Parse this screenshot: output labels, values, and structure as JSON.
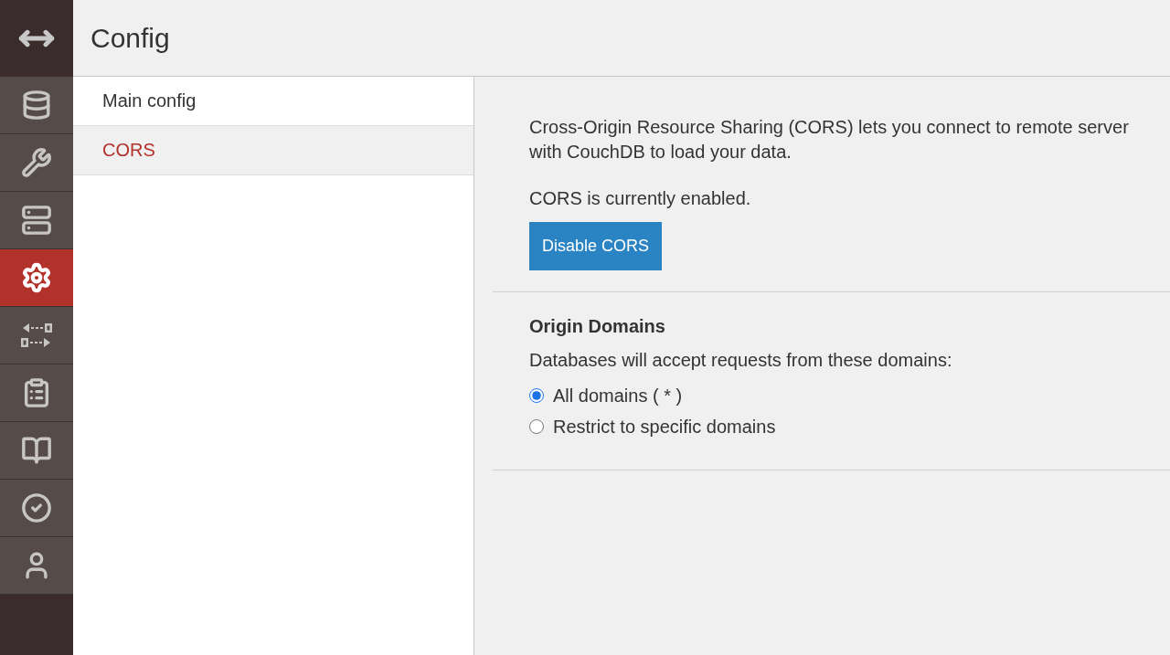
{
  "header": {
    "title": "Config"
  },
  "nav_items": [
    {
      "selected": false
    },
    {
      "selected": false
    },
    {
      "selected": false
    },
    {
      "selected": true
    },
    {
      "selected": false
    },
    {
      "selected": false
    },
    {
      "selected": false
    },
    {
      "selected": false
    },
    {
      "selected": false
    }
  ],
  "config_menu": [
    {
      "label": "Main config",
      "selected": false
    },
    {
      "label": "CORS",
      "selected": true
    }
  ],
  "cors": {
    "description_lines": [
      "Cross-Origin Resource Sharing (CORS) lets you connect to remote server",
      "with CouchDB to load your data."
    ],
    "status": "CORS is currently enabled.",
    "button": "Disable CORS"
  },
  "origin_domains": {
    "heading": "Origin Domains",
    "hint": "Databases will accept requests from these domains:",
    "options": [
      {
        "label": "All domains ( * )",
        "selected": true
      },
      {
        "label": "Restrict to specific domains",
        "selected": false
      }
    ]
  }
}
